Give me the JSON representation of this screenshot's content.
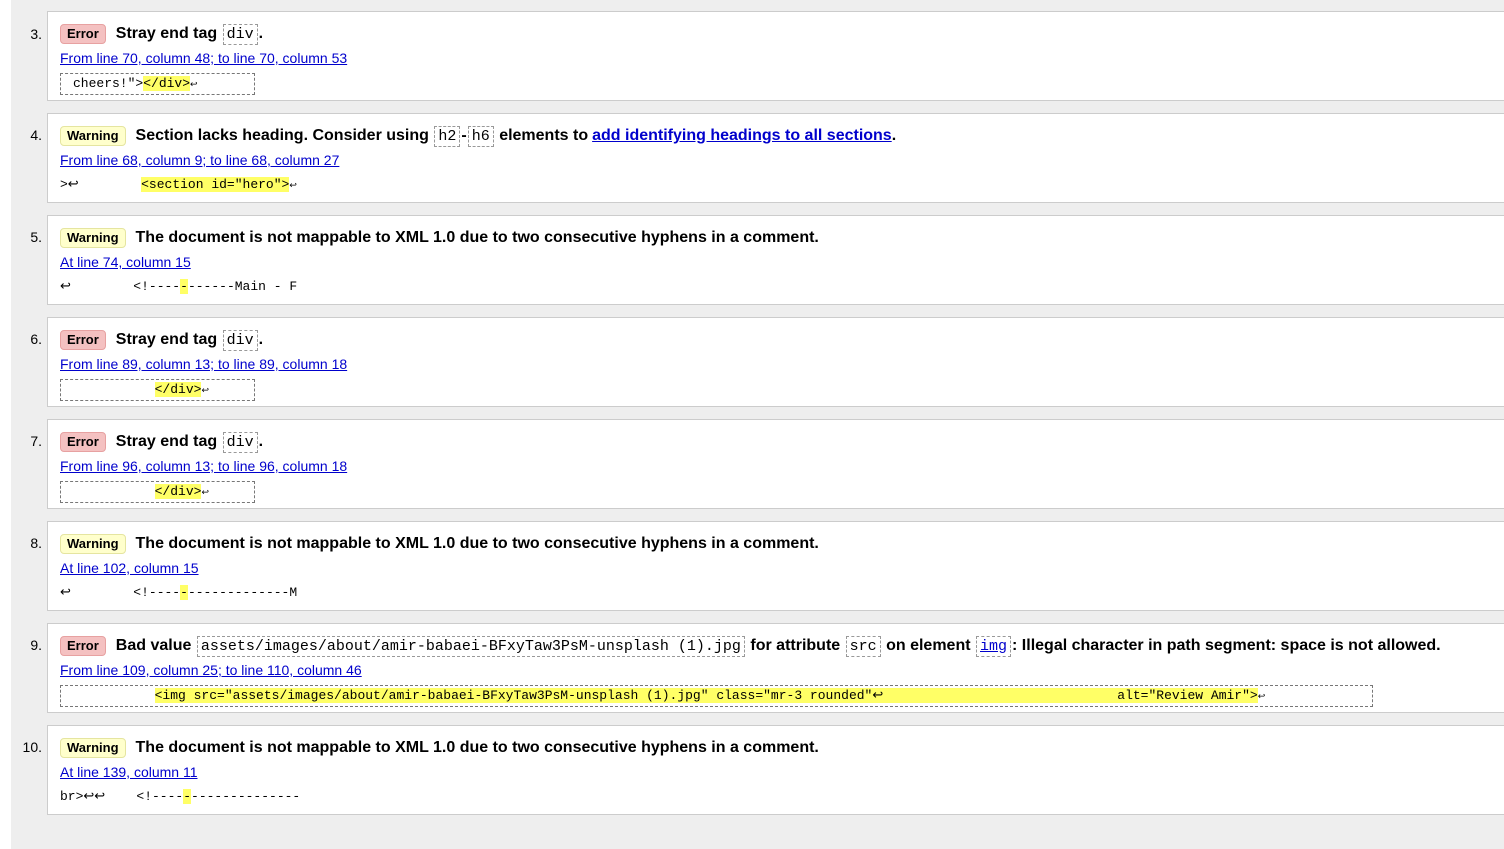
{
  "messages": [
    {
      "num": "3.",
      "type_label": "Error",
      "title": "Stray end tag",
      "code": "div",
      "suffix": ".",
      "location": "From line 70, column 48; to line 70, column 53",
      "extract_pre": "cheers!\">",
      "extract_hl": "</div>",
      "extract_post": "↩"
    },
    {
      "num": "4.",
      "type_label": "Warning",
      "title": "Section lacks heading. Consider using",
      "code_a": "h2",
      "dash": "-",
      "code_b": "h6",
      "mid": "elements to",
      "link": "add identifying headings to all sections",
      "suffix": ".",
      "location": "From line 68, column 9; to line 68, column 27",
      "extract_pre": ">↩        ",
      "extract_hl": "<section id=\"hero\">",
      "extract_post": "↩"
    },
    {
      "num": "5.",
      "type_label": "Warning",
      "title": "The document is not mappable to XML 1.0 due to two consecutive hyphens in a comment.",
      "location": "At line 74, column 15",
      "extract_pre": "↩        <!----",
      "extract_hl": "-",
      "extract_post": "------Main - F"
    },
    {
      "num": "6.",
      "type_label": "Error",
      "title": "Stray end tag",
      "code": "div",
      "suffix": ".",
      "location": "From line 89, column 13; to line 89, column 18",
      "extract_pre": "            ",
      "extract_hl": "</div>",
      "extract_post": "↩"
    },
    {
      "num": "7.",
      "type_label": "Error",
      "title": "Stray end tag",
      "code": "div",
      "suffix": ".",
      "location": "From line 96, column 13; to line 96, column 18",
      "extract_pre": "            ",
      "extract_hl": "</div>",
      "extract_post": "↩"
    },
    {
      "num": "8.",
      "type_label": "Warning",
      "title": "The document is not mappable to XML 1.0 due to two consecutive hyphens in a comment.",
      "location": "At line 102, column 15",
      "extract_pre": "↩        <!----",
      "extract_hl": "-",
      "extract_post": "-------------M"
    },
    {
      "num": "9.",
      "type_label": "Error",
      "title": "Bad value",
      "code_a": "assets/images/about/amir-babaei-BFxyTaw3PsM-unsplash (1).jpg",
      "mid_a": "for attribute",
      "code_b": "src",
      "mid_b": "on element",
      "code_c": "img",
      "tail": ": Illegal character in path segment: space is not allowed.",
      "location": "From line 109, column 25; to line 110, column 46",
      "extract_pre": "            ",
      "extract_hl": "<img src=\"assets/images/about/amir-babaei-BFxyTaw3PsM-unsplash (1).jpg\" class=\"mr-3 rounded\"↩                              alt=\"Review Amir\">",
      "extract_post": "↩"
    },
    {
      "num": "10.",
      "type_label": "Warning",
      "title": "The document is not mappable to XML 1.0 due to two consecutive hyphens in a comment.",
      "location": "At line 139, column 11",
      "extract_pre": "br>↩↩    <!----",
      "extract_hl": "-",
      "extract_post": "--------------"
    }
  ]
}
